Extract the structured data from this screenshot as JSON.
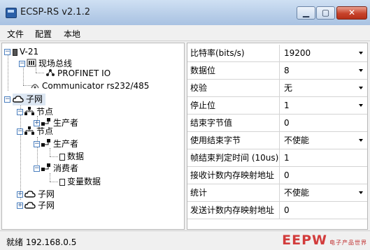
{
  "window": {
    "title": "ECSP-RS v2.1.2"
  },
  "menu": [
    "文件",
    "配置",
    "本地"
  ],
  "tree": {
    "root": "V-21",
    "fieldbus": "现场总线",
    "profinet": "PROFINET IO",
    "communicator": "Communicator rs232/485",
    "subnet": "子网",
    "node1": "节点",
    "producer1": "生产者",
    "node2": "节点",
    "producer2": "生产者",
    "data": "数据",
    "consumer": "消费者",
    "variable_data": "变量数据",
    "subnet2": "子网",
    "subnet3": "子网"
  },
  "properties": [
    {
      "label": "比特率(bits/s)",
      "value": "19200",
      "dropdown": true
    },
    {
      "label": "数据位",
      "value": "8",
      "dropdown": true
    },
    {
      "label": "校验",
      "value": "无",
      "dropdown": true
    },
    {
      "label": "停止位",
      "value": "1",
      "dropdown": true
    },
    {
      "label": "结束字节值",
      "value": "0",
      "dropdown": false
    },
    {
      "label": "使用结束字节",
      "value": "不使能",
      "dropdown": true
    },
    {
      "label": "帧结束判定时间 (10us)",
      "value": "1",
      "dropdown": false
    },
    {
      "label": "接收计数内存映射地址",
      "value": "0",
      "dropdown": false
    },
    {
      "label": "统计",
      "value": "不使能",
      "dropdown": true
    },
    {
      "label": "发送计数内存映射地址",
      "value": "0",
      "dropdown": false
    }
  ],
  "status": {
    "text": "就绪  192.168.0.5"
  },
  "watermark": {
    "main": "EEPW",
    "sub": "电子产品世界"
  }
}
